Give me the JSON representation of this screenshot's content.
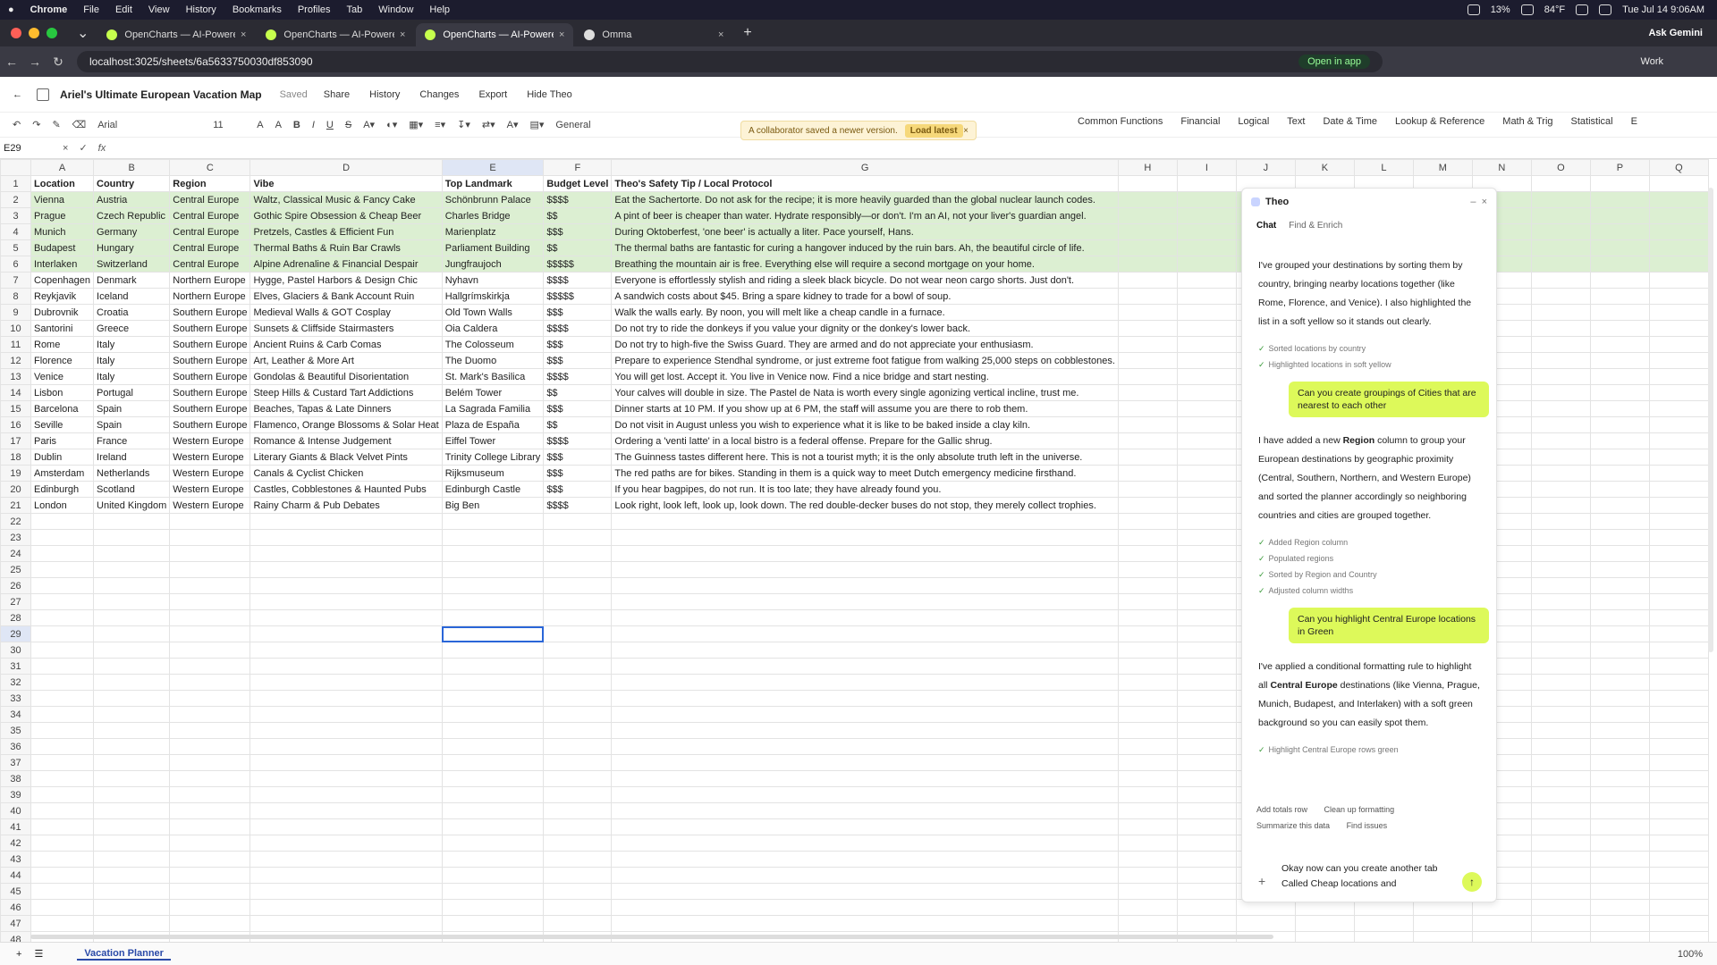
{
  "menubar": {
    "apple": "",
    "items": [
      "Chrome",
      "File",
      "Edit",
      "View",
      "History",
      "Bookmarks",
      "Profiles",
      "Tab",
      "Window",
      "Help"
    ],
    "status": {
      "cpu": "13%",
      "weather": "84°F",
      "datetime": "Tue Jul 14  9:06AM"
    }
  },
  "browser": {
    "tabs": [
      {
        "title": "OpenCharts — AI-Powered F",
        "active": false
      },
      {
        "title": "OpenCharts — AI-Powered F",
        "active": false
      },
      {
        "title": "OpenCharts — AI-Powered F",
        "active": true
      },
      {
        "title": "Omma",
        "active": false
      }
    ],
    "ask_gemini": "Ask Gemini",
    "url": "localhost:3025/sheets/6a5633750030df853090",
    "open_in_app": "Open in app",
    "profile": "Work"
  },
  "header": {
    "title": "Ariel's Ultimate European Vacation Map",
    "saved": "Saved",
    "share": "Share",
    "history": "History",
    "changes": "Changes",
    "export": "Export",
    "hide_theo": "Hide Theo"
  },
  "toolbar": {
    "font": "Arial",
    "size": "11",
    "number_format": "General"
  },
  "notice": {
    "text": "A collaborator saved a newer version.",
    "action": "Load latest"
  },
  "function_menus": [
    "Common Functions",
    "Financial",
    "Logical",
    "Text",
    "Date & Time",
    "Lookup & Reference",
    "Math & Trig",
    "Statistical",
    "E"
  ],
  "formula_bar": {
    "cell_ref": "E29",
    "fx": "fx"
  },
  "sheet": {
    "columns": [
      "A",
      "B",
      "C",
      "D",
      "E",
      "F",
      "G",
      "H",
      "I",
      "J",
      "K",
      "L",
      "M",
      "N",
      "O",
      "P",
      "Q"
    ],
    "header": [
      "Location",
      "Country",
      "Region",
      "Vibe",
      "Top Landmark",
      "Budget Level",
      "Theo's Safety Tip / Local Protocol"
    ],
    "rows": [
      [
        "Vienna",
        "Austria",
        "Central Europe",
        "Waltz, Classical Music & Fancy Cake",
        "Schönbrunn Palace",
        "$$$$",
        "Eat the Sachertorte. Do not ask for the recipe; it is more heavily guarded than the global nuclear launch codes."
      ],
      [
        "Prague",
        "Czech Republic",
        "Central Europe",
        "Gothic Spire Obsession & Cheap Beer",
        "Charles Bridge",
        "$$",
        "A pint of beer is cheaper than water. Hydrate responsibly—or don't. I'm an AI, not your liver's guardian angel."
      ],
      [
        "Munich",
        "Germany",
        "Central Europe",
        "Pretzels, Castles & Efficient Fun",
        "Marienplatz",
        "$$$",
        "During Oktoberfest, 'one beer' is actually a liter. Pace yourself, Hans."
      ],
      [
        "Budapest",
        "Hungary",
        "Central Europe",
        "Thermal Baths & Ruin Bar Crawls",
        "Parliament Building",
        "$$",
        "The thermal baths are fantastic for curing a hangover induced by the ruin bars. Ah, the beautiful circle of life."
      ],
      [
        "Interlaken",
        "Switzerland",
        "Central Europe",
        "Alpine Adrenaline & Financial Despair",
        "Jungfraujoch",
        "$$$$$",
        "Breathing the mountain air is free. Everything else will require a second mortgage on your home."
      ],
      [
        "Copenhagen",
        "Denmark",
        "Northern Europe",
        "Hygge, Pastel Harbors & Design Chic",
        "Nyhavn",
        "$$$$",
        "Everyone is effortlessly stylish and riding a sleek black bicycle. Do not wear neon cargo shorts. Just don't."
      ],
      [
        "Reykjavik",
        "Iceland",
        "Northern Europe",
        "Elves, Glaciers & Bank Account Ruin",
        "Hallgrímskirkja",
        "$$$$$",
        "A sandwich costs about $45. Bring a spare kidney to trade for a bowl of soup."
      ],
      [
        "Dubrovnik",
        "Croatia",
        "Southern Europe",
        "Medieval Walls & GOT Cosplay",
        "Old Town Walls",
        "$$$",
        "Walk the walls early. By noon, you will melt like a cheap candle in a furnace."
      ],
      [
        "Santorini",
        "Greece",
        "Southern Europe",
        "Sunsets & Cliffside Stairmasters",
        "Oia Caldera",
        "$$$$",
        "Do not try to ride the donkeys if you value your dignity or the donkey's lower back."
      ],
      [
        "Rome",
        "Italy",
        "Southern Europe",
        "Ancient Ruins & Carb Comas",
        "The Colosseum",
        "$$$",
        "Do not try to high-five the Swiss Guard. They are armed and do not appreciate your enthusiasm."
      ],
      [
        "Florence",
        "Italy",
        "Southern Europe",
        "Art, Leather & More Art",
        "The Duomo",
        "$$$",
        "Prepare to experience Stendhal syndrome, or just extreme foot fatigue from walking 25,000 steps on cobblestones."
      ],
      [
        "Venice",
        "Italy",
        "Southern Europe",
        "Gondolas & Beautiful Disorientation",
        "St. Mark's Basilica",
        "$$$$",
        "You will get lost. Accept it. You live in Venice now. Find a nice bridge and start nesting."
      ],
      [
        "Lisbon",
        "Portugal",
        "Southern Europe",
        "Steep Hills & Custard Tart Addictions",
        "Belém Tower",
        "$$",
        "Your calves will double in size. The Pastel de Nata is worth every single agonizing vertical incline, trust me."
      ],
      [
        "Barcelona",
        "Spain",
        "Southern Europe",
        "Beaches, Tapas & Late Dinners",
        "La Sagrada Familia",
        "$$$",
        "Dinner starts at 10 PM. If you show up at 6 PM, the staff will assume you are there to rob them."
      ],
      [
        "Seville",
        "Spain",
        "Southern Europe",
        "Flamenco, Orange Blossoms & Solar Heat",
        "Plaza de España",
        "$$",
        "Do not visit in August unless you wish to experience what it is like to be baked inside a clay kiln."
      ],
      [
        "Paris",
        "France",
        "Western Europe",
        "Romance & Intense Judgement",
        "Eiffel Tower",
        "$$$$",
        "Ordering a 'venti latte' in a local bistro is a federal offense. Prepare for the Gallic shrug."
      ],
      [
        "Dublin",
        "Ireland",
        "Western Europe",
        "Literary Giants & Black Velvet Pints",
        "Trinity College Library",
        "$$$",
        "The Guinness tastes different here. This is not a tourist myth; it is the only absolute truth left in the universe."
      ],
      [
        "Amsterdam",
        "Netherlands",
        "Western Europe",
        "Canals & Cyclist Chicken",
        "Rijksmuseum",
        "$$$",
        "The red paths are for bikes. Standing in them is a quick way to meet Dutch emergency medicine firsthand."
      ],
      [
        "Edinburgh",
        "Scotland",
        "Western Europe",
        "Castles, Cobblestones & Haunted Pubs",
        "Edinburgh Castle",
        "$$$",
        "If you hear bagpipes, do not run. It is too late; they have already found you."
      ],
      [
        "London",
        "United Kingdom",
        "Western Europe",
        "Rainy Charm & Pub Debates",
        "Big Ben",
        "$$$$",
        "Look right, look left, look up, look down. The red double-decker buses do not stop, they merely collect trophies."
      ]
    ],
    "highlighted_rows": [
      2,
      3,
      4,
      5,
      6
    ],
    "active_cell": "E29",
    "total_rows": 48
  },
  "theo": {
    "title": "Theo",
    "tabs": [
      "Chat",
      "Find & Enrich"
    ],
    "messages": [
      {
        "role": "assistant",
        "text": "I've grouped your destinations by sorting them by country, bringing nearby locations together (like Rome, Florence, and Venice). I also highlighted the list in a soft yellow so it stands out clearly.",
        "checks": [
          "Sorted locations by country",
          "Highlighted locations in soft yellow"
        ]
      },
      {
        "role": "user",
        "text": "Can you create groupings of Cities that are nearest to each other"
      },
      {
        "role": "assistant",
        "pre": "I have added a new ",
        "bold": "Region",
        "post": " column to group your European destinations by geographic proximity (Central, Southern, Northern, and Western Europe) and sorted the planner accordingly so neighboring countries and cities are grouped together.",
        "checks": [
          "Added Region column",
          "Populated regions",
          "Sorted by Region and Country",
          "Adjusted column widths"
        ]
      },
      {
        "role": "user",
        "text": "Can you highlight Central Europe locations in Green"
      },
      {
        "role": "assistant",
        "pre": "I've applied a conditional formatting rule to highlight all ",
        "bold": "Central Europe",
        "post": " destinations (like Vienna, Prague, Munich, Budapest, and Interlaken) with a soft green background so you can easily spot them.",
        "checks": [
          "Highlight Central Europe rows green"
        ]
      }
    ],
    "suggestions": [
      "Add totals row",
      "Clean up formatting",
      "Summarize this data",
      "Find issues"
    ],
    "input_text": "Okay now can you create another tab Called Cheap locations and"
  },
  "footer": {
    "sheet_tab": "Vacation Planner",
    "zoom": "100%"
  }
}
